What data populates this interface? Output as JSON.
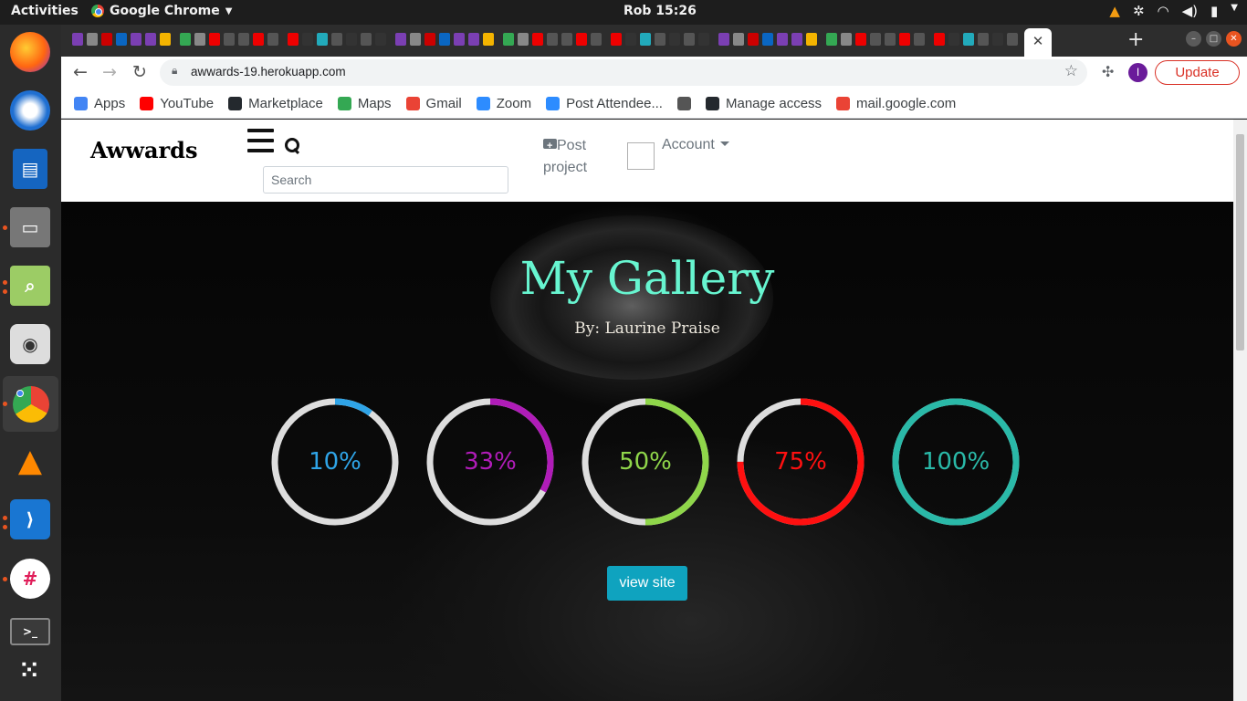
{
  "system_bar": {
    "activities": "Activities",
    "app_name": "Google Chrome",
    "clock": "Rob 15:26"
  },
  "browser": {
    "url": "awwards-19.herokuapp.com",
    "profile_initial": "I",
    "update_label": "Update",
    "active_tab_close": "✕",
    "bookmarks": [
      {
        "label": "Apps",
        "icon": "apps-grid-icon",
        "color": "#4285f4"
      },
      {
        "label": "YouTube",
        "icon": "youtube-icon",
        "color": "#ff0000"
      },
      {
        "label": "Marketplace",
        "icon": "github-icon",
        "color": "#24292e"
      },
      {
        "label": "Maps",
        "icon": "maps-pin-icon",
        "color": "#34a853"
      },
      {
        "label": "Gmail",
        "icon": "gmail-icon",
        "color": "#ea4335"
      },
      {
        "label": "Zoom",
        "icon": "zoom-icon",
        "color": "#2d8cff"
      },
      {
        "label": "Post Attendee...",
        "icon": "zoom-video-icon",
        "color": "#2d8cff"
      },
      {
        "label": "",
        "icon": "circle-logo-icon",
        "color": "#555555"
      },
      {
        "label": "Manage access",
        "icon": "github-icon",
        "color": "#24292e"
      },
      {
        "label": "mail.google.com",
        "icon": "gmail-icon",
        "color": "#ea4335"
      }
    ]
  },
  "site": {
    "brand": "Awwards",
    "search_placeholder": "Search",
    "post_project": "Post project",
    "account": "Account",
    "hero": {
      "title": "My Gallery",
      "subtitle": "By: Laurine Praise",
      "view_site": "view site"
    },
    "progress_rings": [
      {
        "label": "10%",
        "value": 0.1,
        "color": "#2fa4e7"
      },
      {
        "label": "33%",
        "value": 0.33,
        "color": "#b01cb8"
      },
      {
        "label": "50%",
        "value": 0.5,
        "color": "#8fd64a"
      },
      {
        "label": "75%",
        "value": 0.75,
        "color": "#ff1010"
      },
      {
        "label": "100%",
        "value": 1.0,
        "color": "#2ab9a8"
      }
    ]
  }
}
